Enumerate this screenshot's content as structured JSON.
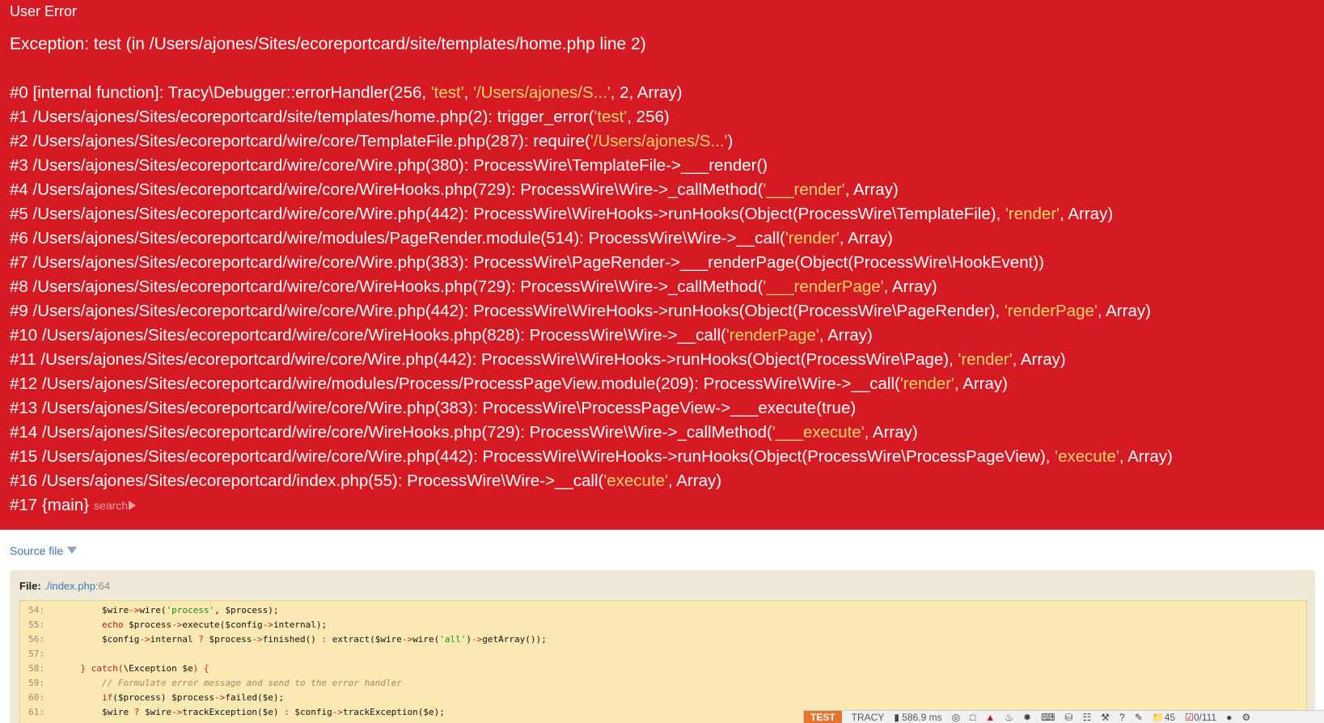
{
  "error": {
    "type": "User Error",
    "message": "Exception: test (in /Users/ajones/Sites/ecoreportcard/site/templates/home.php line 2)"
  },
  "trace": [
    {
      "idx": "#0",
      "parts": [
        {
          "t": " [internal function]: Tracy\\Debugger::errorHandler(256, "
        },
        {
          "t": "'test'",
          "s": 1
        },
        {
          "t": ", "
        },
        {
          "t": "'/Users/ajones/S...'",
          "s": 1
        },
        {
          "t": ", 2, Array)"
        }
      ]
    },
    {
      "idx": "#1",
      "parts": [
        {
          "t": " /Users/ajones/Sites/ecoreportcard/site/templates/home.php(2): trigger_error("
        },
        {
          "t": "'test'",
          "s": 1
        },
        {
          "t": ", 256)"
        }
      ]
    },
    {
      "idx": "#2",
      "parts": [
        {
          "t": " /Users/ajones/Sites/ecoreportcard/wire/core/TemplateFile.php(287): require("
        },
        {
          "t": "'/Users/ajones/S...'",
          "s": 1
        },
        {
          "t": ")"
        }
      ]
    },
    {
      "idx": "#3",
      "parts": [
        {
          "t": " /Users/ajones/Sites/ecoreportcard/wire/core/Wire.php(380): ProcessWire\\TemplateFile->___render()"
        }
      ]
    },
    {
      "idx": "#4",
      "parts": [
        {
          "t": " /Users/ajones/Sites/ecoreportcard/wire/core/WireHooks.php(729): ProcessWire\\Wire->_callMethod("
        },
        {
          "t": "'___render'",
          "s": 1
        },
        {
          "t": ", Array)"
        }
      ]
    },
    {
      "idx": "#5",
      "parts": [
        {
          "t": " /Users/ajones/Sites/ecoreportcard/wire/core/Wire.php(442): ProcessWire\\WireHooks->runHooks(Object(ProcessWire\\TemplateFile), "
        },
        {
          "t": "'render'",
          "s": 1
        },
        {
          "t": ", Array)"
        }
      ]
    },
    {
      "idx": "#6",
      "parts": [
        {
          "t": " /Users/ajones/Sites/ecoreportcard/wire/modules/PageRender.module(514): ProcessWire\\Wire->__call("
        },
        {
          "t": "'render'",
          "s": 1
        },
        {
          "t": ", Array)"
        }
      ]
    },
    {
      "idx": "#7",
      "parts": [
        {
          "t": " /Users/ajones/Sites/ecoreportcard/wire/core/Wire.php(383): ProcessWire\\PageRender->___renderPage(Object(ProcessWire\\HookEvent))"
        }
      ]
    },
    {
      "idx": "#8",
      "parts": [
        {
          "t": " /Users/ajones/Sites/ecoreportcard/wire/core/WireHooks.php(729): ProcessWire\\Wire->_callMethod("
        },
        {
          "t": "'___renderPage'",
          "s": 1
        },
        {
          "t": ", Array)"
        }
      ]
    },
    {
      "idx": "#9",
      "parts": [
        {
          "t": " /Users/ajones/Sites/ecoreportcard/wire/core/Wire.php(442): ProcessWire\\WireHooks->runHooks(Object(ProcessWire\\PageRender), "
        },
        {
          "t": "'renderPage'",
          "s": 1
        },
        {
          "t": ", Array)"
        }
      ]
    },
    {
      "idx": "#10",
      "parts": [
        {
          "t": " /Users/ajones/Sites/ecoreportcard/wire/core/WireHooks.php(828): ProcessWire\\Wire->__call("
        },
        {
          "t": "'renderPage'",
          "s": 1
        },
        {
          "t": ", Array)"
        }
      ]
    },
    {
      "idx": "#11",
      "parts": [
        {
          "t": " /Users/ajones/Sites/ecoreportcard/wire/core/Wire.php(442): ProcessWire\\WireHooks->runHooks(Object(ProcessWire\\Page), "
        },
        {
          "t": "'render'",
          "s": 1
        },
        {
          "t": ", Array)"
        }
      ]
    },
    {
      "idx": "#12",
      "parts": [
        {
          "t": " /Users/ajones/Sites/ecoreportcard/wire/modules/Process/ProcessPageView.module(209): ProcessWire\\Wire->__call("
        },
        {
          "t": "'render'",
          "s": 1
        },
        {
          "t": ", Array)"
        }
      ]
    },
    {
      "idx": "#13",
      "parts": [
        {
          "t": " /Users/ajones/Sites/ecoreportcard/wire/core/Wire.php(383): ProcessWire\\ProcessPageView->___execute(true)"
        }
      ]
    },
    {
      "idx": "#14",
      "parts": [
        {
          "t": " /Users/ajones/Sites/ecoreportcard/wire/core/WireHooks.php(729): ProcessWire\\Wire->_callMethod("
        },
        {
          "t": "'___execute'",
          "s": 1
        },
        {
          "t": ", Array)"
        }
      ]
    },
    {
      "idx": "#15",
      "parts": [
        {
          "t": " /Users/ajones/Sites/ecoreportcard/wire/core/Wire.php(442): ProcessWire\\WireHooks->runHooks(Object(ProcessWire\\ProcessPageView), "
        },
        {
          "t": "'execute'",
          "s": 1
        },
        {
          "t": ", Array)"
        }
      ]
    },
    {
      "idx": "#16",
      "parts": [
        {
          "t": " /Users/ajones/Sites/ecoreportcard/index.php(55): ProcessWire\\Wire->__call("
        },
        {
          "t": "'execute'",
          "s": 1
        },
        {
          "t": ", Array)"
        }
      ]
    },
    {
      "idx": "#17",
      "parts": [
        {
          "t": " {main}"
        }
      ]
    }
  ],
  "search_label": "search",
  "source": {
    "toggle_label": "Source file",
    "file_label": "File:",
    "file_path": "./index.php",
    "file_line": ":64",
    "lines": [
      {
        "n": "54:",
        "tokens": [
          {
            "t": "        $wire"
          },
          {
            "t": "->",
            "c": "op"
          },
          {
            "t": "wire("
          },
          {
            "t": "'process'",
            "c": "sq"
          },
          {
            "t": ", $process);"
          }
        ]
      },
      {
        "n": "55:",
        "tokens": [
          {
            "t": "        "
          },
          {
            "t": "echo",
            "c": "kw"
          },
          {
            "t": " $process"
          },
          {
            "t": "->",
            "c": "op"
          },
          {
            "t": "execute($config"
          },
          {
            "t": "->",
            "c": "op"
          },
          {
            "t": "internal);"
          }
        ]
      },
      {
        "n": "56:",
        "tokens": [
          {
            "t": "        $config"
          },
          {
            "t": "->",
            "c": "op"
          },
          {
            "t": "internal "
          },
          {
            "t": "?",
            "c": "op"
          },
          {
            "t": " $process"
          },
          {
            "t": "->",
            "c": "op"
          },
          {
            "t": "finished() "
          },
          {
            "t": ":",
            "c": "op"
          },
          {
            "t": " extract($wire"
          },
          {
            "t": "->",
            "c": "op"
          },
          {
            "t": "wire("
          },
          {
            "t": "'all'",
            "c": "sq"
          },
          {
            "t": ")"
          },
          {
            "t": "->",
            "c": "op"
          },
          {
            "t": "getArray());"
          }
        ]
      },
      {
        "n": "57:",
        "tokens": [
          {
            "t": ""
          }
        ]
      },
      {
        "n": "58:",
        "tokens": [
          {
            "t": "    "
          },
          {
            "t": "} catch(",
            "c": "kw"
          },
          {
            "t": "\\Exception $e"
          },
          {
            "t": ") {",
            "c": "kw"
          }
        ]
      },
      {
        "n": "59:",
        "tokens": [
          {
            "t": "        "
          },
          {
            "t": "// Formulate error message and send to the error handler",
            "c": "cm"
          }
        ]
      },
      {
        "n": "60:",
        "tokens": [
          {
            "t": "        "
          },
          {
            "t": "if",
            "c": "kw"
          },
          {
            "t": "($process) $process"
          },
          {
            "t": "->",
            "c": "op"
          },
          {
            "t": "failed($e);"
          }
        ]
      },
      {
        "n": "61:",
        "tokens": [
          {
            "t": "        $wire "
          },
          {
            "t": "?",
            "c": "op"
          },
          {
            "t": " $wire"
          },
          {
            "t": "->",
            "c": "op"
          },
          {
            "t": "trackException($e) "
          },
          {
            "t": ":",
            "c": "op"
          },
          {
            "t": " $config"
          },
          {
            "t": "->",
            "c": "op"
          },
          {
            "t": "trackException($e);"
          }
        ]
      }
    ]
  },
  "tracy_bar": {
    "env_badge": "TEST",
    "brand": "TRACY",
    "time": "586.9 ms",
    "folder_count": "45",
    "todo_count": "0/111"
  },
  "colors": {
    "error_bg": "#d51a23",
    "string_highlight": "#ffd66b",
    "code_bg": "#fbe9b3",
    "panel_bg": "#efe9d8",
    "link": "#3b77b8"
  }
}
